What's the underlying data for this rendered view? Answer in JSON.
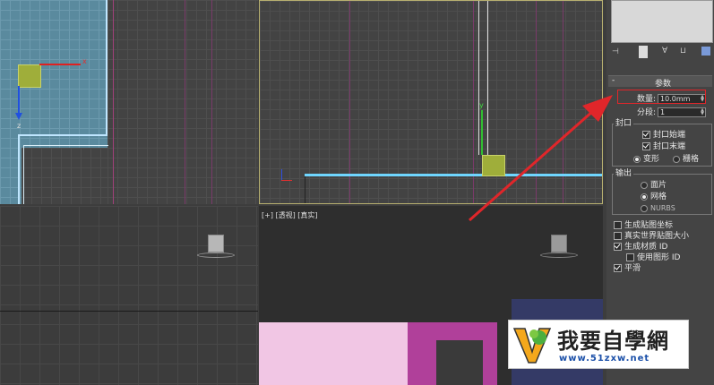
{
  "viewports": {
    "bottom_right_label": "[+] [透视] [真实]",
    "axes": {
      "x": "x",
      "y": "y",
      "z": "z"
    }
  },
  "panel": {
    "rollout_title": "参数",
    "amount_label": "数量:",
    "amount_value": "10.0mm",
    "segments_label": "分段:",
    "segments_value": "1",
    "capping": {
      "title": "封口",
      "cap_start": "封口始端",
      "cap_end": "封口末端",
      "morph": "变形",
      "grid": "栅格"
    },
    "output": {
      "title": "输出",
      "patch": "面片",
      "mesh": "网格",
      "nurbs": "NURBS"
    },
    "options": {
      "gen_map_coords": "生成贴图坐标",
      "real_world_map": "真实世界贴图大小",
      "gen_mat_ids": "生成材质 ID",
      "use_shape_ids": "使用图形 ID",
      "smooth": "平滑"
    }
  },
  "watermark": {
    "title": "我要自學網",
    "url": "www.51zxw.net"
  },
  "colors": {
    "annotation_red": "#e0262a",
    "selection_yellow": "#9fae3a",
    "viewport_border": "#b8b070"
  }
}
